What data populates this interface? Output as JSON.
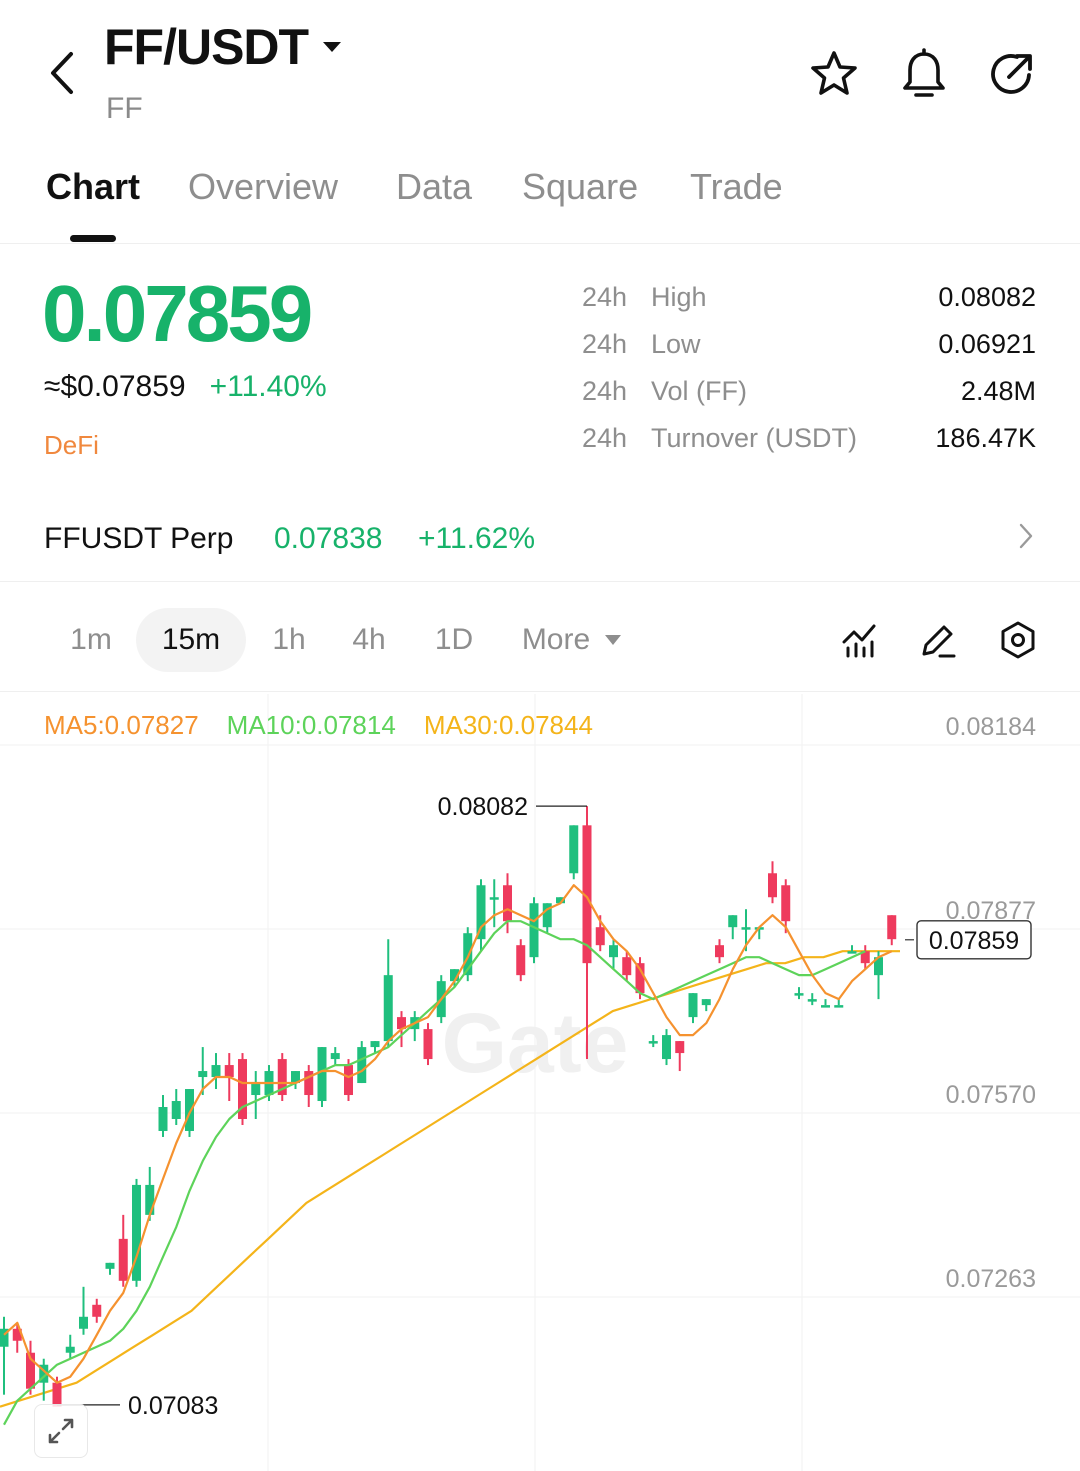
{
  "header": {
    "pair": "FF/USDT",
    "sub": "FF"
  },
  "icons": {
    "back": "chevron-left-icon",
    "dropdown": "caret-down-icon",
    "favorite": "star-icon",
    "alert": "bell-icon",
    "share": "share-icon"
  },
  "tabs": [
    "Chart",
    "Overview",
    "Data",
    "Square",
    "Trade"
  ],
  "price": {
    "last": "0.07859",
    "usd": "≈$0.07859",
    "change": "+11.40%",
    "tag": "DeFi"
  },
  "stats": [
    {
      "period": "24h",
      "label": "High",
      "value": "0.08082"
    },
    {
      "period": "24h",
      "label": "Low",
      "value": "0.06921"
    },
    {
      "period": "24h",
      "label": "Vol (FF)",
      "value": "2.48M"
    },
    {
      "period": "24h",
      "label": "Turnover (USDT)",
      "value": "186.47K"
    }
  ],
  "perp": {
    "name": "FFUSDT Perp",
    "price": "0.07838",
    "change": "+11.62%"
  },
  "intervals": [
    "1m",
    "15m",
    "1h",
    "4h",
    "1D",
    "More"
  ],
  "active_interval": "15m",
  "chart_legend": {
    "ma5": "MA5:0.07827",
    "ma10": "MA10:0.07814",
    "ma30": "MA30:0.07844"
  },
  "watermark": "Gate",
  "colors": {
    "up": "#17b26a",
    "candle_up": "#1fbf7e",
    "candle_down": "#ee3a5d",
    "ma5": "#f5922f",
    "ma10": "#5dd35a",
    "ma30": "#f4b41a",
    "tag": "#f0883e"
  },
  "chart_data": {
    "type": "candlestick",
    "interval": "15m",
    "y_ticks": [
      "0.08184",
      "0.07877",
      "0.07570",
      "0.07263"
    ],
    "y_tick_values": [
      0.08184,
      0.07877,
      0.0757,
      0.07263
    ],
    "last_price_label": "0.07859",
    "last_price": 0.07859,
    "high_label": "0.08082",
    "high": 0.08082,
    "low_label": "0.07083",
    "low": 0.07083,
    "candles": [
      [
        0.0718,
        0.0721,
        0.071,
        0.0723
      ],
      [
        0.0721,
        0.0719,
        0.0717,
        0.0722
      ],
      [
        0.0717,
        0.0711,
        0.071,
        0.0719
      ],
      [
        0.0712,
        0.0715,
        0.0709,
        0.0716
      ],
      [
        0.0712,
        0.0708,
        0.07083,
        0.0713
      ],
      [
        0.0717,
        0.0718,
        0.0716,
        0.072
      ],
      [
        0.0721,
        0.0723,
        0.072,
        0.0728
      ],
      [
        0.0725,
        0.0723,
        0.0722,
        0.0726
      ],
      [
        0.0731,
        0.0732,
        0.073,
        0.0732
      ],
      [
        0.0736,
        0.0729,
        0.0728,
        0.074
      ],
      [
        0.0729,
        0.0745,
        0.0728,
        0.0746
      ],
      [
        0.074,
        0.0745,
        0.0739,
        0.0748
      ],
      [
        0.0754,
        0.0758,
        0.0753,
        0.076
      ],
      [
        0.0756,
        0.0759,
        0.0755,
        0.0761
      ],
      [
        0.0754,
        0.0761,
        0.0753,
        0.0761
      ],
      [
        0.0763,
        0.0764,
        0.076,
        0.0768
      ],
      [
        0.0763,
        0.0765,
        0.0761,
        0.0767
      ],
      [
        0.0765,
        0.0763,
        0.0759,
        0.0767
      ],
      [
        0.0766,
        0.0756,
        0.0755,
        0.0767
      ],
      [
        0.076,
        0.0762,
        0.0756,
        0.0764
      ],
      [
        0.076,
        0.0764,
        0.0759,
        0.0765
      ],
      [
        0.0766,
        0.076,
        0.0759,
        0.0767
      ],
      [
        0.0762,
        0.0764,
        0.0761,
        0.0764
      ],
      [
        0.0764,
        0.076,
        0.0758,
        0.0765
      ],
      [
        0.0759,
        0.0768,
        0.0758,
        0.0768
      ],
      [
        0.0766,
        0.0767,
        0.0765,
        0.0768
      ],
      [
        0.0765,
        0.076,
        0.0759,
        0.0766
      ],
      [
        0.0762,
        0.0768,
        0.0762,
        0.0769
      ],
      [
        0.0768,
        0.0769,
        0.0767,
        0.0769
      ],
      [
        0.0769,
        0.078,
        0.0768,
        0.0786
      ],
      [
        0.0773,
        0.0771,
        0.0768,
        0.0774
      ],
      [
        0.0771,
        0.0773,
        0.0769,
        0.0774
      ],
      [
        0.0771,
        0.0766,
        0.0765,
        0.0772
      ],
      [
        0.0773,
        0.0779,
        0.0772,
        0.078
      ],
      [
        0.0779,
        0.0781,
        0.0778,
        0.0781
      ],
      [
        0.078,
        0.0787,
        0.0779,
        0.0788
      ],
      [
        0.0786,
        0.0795,
        0.0784,
        0.0796
      ],
      [
        0.0793,
        0.0793,
        0.0788,
        0.0796
      ],
      [
        0.0795,
        0.0789,
        0.0787,
        0.0797
      ],
      [
        0.0785,
        0.078,
        0.0779,
        0.0786
      ],
      [
        0.0783,
        0.0792,
        0.0782,
        0.0793
      ],
      [
        0.0788,
        0.0792,
        0.0787,
        0.0792
      ],
      [
        0.0792,
        0.0793,
        0.0792,
        0.0793
      ],
      [
        0.0797,
        0.0805,
        0.0796,
        0.0805
      ],
      [
        0.0805,
        0.0782,
        0.0766,
        0.08082
      ],
      [
        0.0788,
        0.0785,
        0.0784,
        0.079
      ],
      [
        0.0783,
        0.0785,
        0.0781,
        0.0786
      ],
      [
        0.0783,
        0.078,
        0.0779,
        0.0784
      ],
      [
        0.0782,
        0.0777,
        0.0776,
        0.0783
      ],
      [
        0.0769,
        0.0769,
        0.0768,
        0.077
      ],
      [
        0.0766,
        0.077,
        0.0765,
        0.0771
      ],
      [
        0.0769,
        0.0767,
        0.0764,
        0.0769
      ],
      [
        0.0773,
        0.0777,
        0.0772,
        0.0777
      ],
      [
        0.0775,
        0.0776,
        0.0774,
        0.0776
      ],
      [
        0.0785,
        0.0783,
        0.0782,
        0.0786
      ],
      [
        0.0788,
        0.079,
        0.0786,
        0.079
      ],
      [
        0.0788,
        0.0788,
        0.0784,
        0.0791
      ],
      [
        0.0788,
        0.0788,
        0.0786,
        0.0788
      ],
      [
        0.0797,
        0.0793,
        0.0792,
        0.0799
      ],
      [
        0.0795,
        0.0789,
        0.0787,
        0.0796
      ],
      [
        0.0777,
        0.0777,
        0.0776,
        0.0778
      ],
      [
        0.0776,
        0.0776,
        0.0775,
        0.0777
      ],
      [
        0.0775,
        0.0775,
        0.0775,
        0.0776
      ],
      [
        0.0775,
        0.0775,
        0.0775,
        0.0776
      ],
      [
        0.0784,
        0.0784,
        0.0784,
        0.0785
      ],
      [
        0.0784,
        0.0782,
        0.0781,
        0.0785
      ],
      [
        0.078,
        0.0783,
        0.0776,
        0.0784
      ],
      [
        0.079,
        0.0786,
        0.0785,
        0.079
      ]
    ],
    "ma5_series": [
      0.072,
      0.0722,
      0.0716,
      0.0714,
      0.0712,
      0.0713,
      0.0716,
      0.072,
      0.0724,
      0.0727,
      0.0733,
      0.074,
      0.0746,
      0.0752,
      0.0757,
      0.0761,
      0.0763,
      0.0763,
      0.0762,
      0.0762,
      0.0762,
      0.0762,
      0.0762,
      0.0763,
      0.0764,
      0.0764,
      0.0763,
      0.0764,
      0.0766,
      0.0769,
      0.0771,
      0.0772,
      0.0773,
      0.0776,
      0.0779,
      0.0783,
      0.0788,
      0.079,
      0.0791,
      0.079,
      0.0789,
      0.0791,
      0.0792,
      0.0795,
      0.0793,
      0.0789,
      0.0786,
      0.0784,
      0.0781,
      0.0777,
      0.0773,
      0.077,
      0.077,
      0.0772,
      0.0776,
      0.0781,
      0.0785,
      0.0788,
      0.079,
      0.0788,
      0.0784,
      0.078,
      0.0777,
      0.0776,
      0.0779,
      0.0781,
      0.0783,
      0.0784
    ],
    "ma10_series": [
      0.0705,
      0.0709,
      0.0711,
      0.0713,
      0.0715,
      0.0716,
      0.0717,
      0.0718,
      0.0719,
      0.0721,
      0.0724,
      0.0728,
      0.0733,
      0.0738,
      0.0744,
      0.0749,
      0.0753,
      0.0756,
      0.0758,
      0.0759,
      0.076,
      0.0761,
      0.0762,
      0.0763,
      0.0764,
      0.0765,
      0.0765,
      0.0766,
      0.0767,
      0.0768,
      0.077,
      0.0772,
      0.0774,
      0.0776,
      0.0778,
      0.0781,
      0.0784,
      0.0787,
      0.0789,
      0.0789,
      0.0788,
      0.0787,
      0.0786,
      0.0786,
      0.0785,
      0.0783,
      0.0781,
      0.0779,
      0.0777,
      0.0776,
      0.0777,
      0.0778,
      0.0779,
      0.078,
      0.0781,
      0.0782,
      0.0783,
      0.0783,
      0.0782,
      0.0781,
      0.078,
      0.078,
      0.0781,
      0.0782,
      0.0783,
      0.0784
    ],
    "ma30_series": [
      0.0708,
      0.0709,
      0.071,
      0.0711,
      0.0712,
      0.0714,
      0.0716,
      0.0718,
      0.072,
      0.0722,
      0.0724,
      0.0727,
      0.073,
      0.0733,
      0.0736,
      0.0739,
      0.0742,
      0.0744,
      0.0746,
      0.0748,
      0.075,
      0.0752,
      0.0754,
      0.0756,
      0.0758,
      0.076,
      0.0762,
      0.0764,
      0.0766,
      0.0768,
      0.077,
      0.0772,
      0.0774,
      0.0775,
      0.0776,
      0.0777,
      0.0778,
      0.0779,
      0.078,
      0.0781,
      0.0782,
      0.0782,
      0.0783,
      0.0783,
      0.0784,
      0.0784,
      0.0784,
      0.0784
    ]
  }
}
